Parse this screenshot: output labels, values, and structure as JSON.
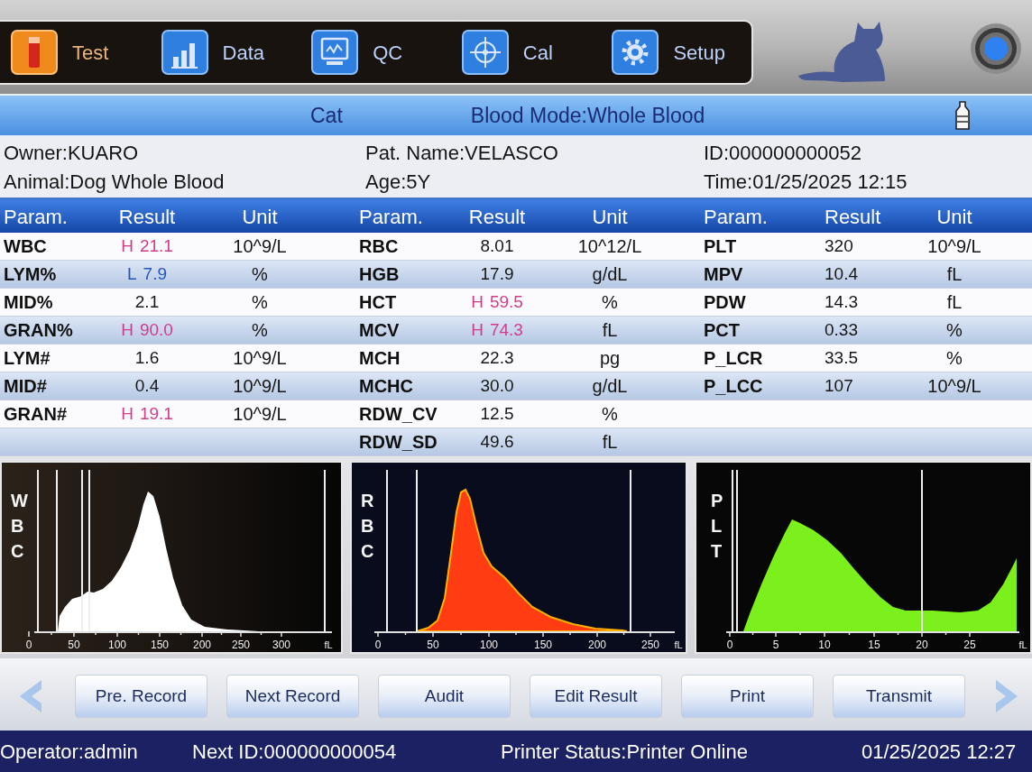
{
  "toolbar": {
    "tabs": [
      {
        "label": "Test",
        "selected": true
      },
      {
        "label": "Data",
        "selected": false
      },
      {
        "label": "QC",
        "selected": false
      },
      {
        "label": "Cal",
        "selected": false
      },
      {
        "label": "Setup",
        "selected": false
      }
    ]
  },
  "mode_bar": {
    "species": "Cat",
    "blood_mode": "Blood Mode:Whole Blood"
  },
  "patient_info": {
    "owner": "Owner:KUARO",
    "patient_name": "Pat. Name:VELASCO",
    "id": "ID:000000000052",
    "animal": "Animal:Dog Whole Blood",
    "age": "Age:5Y",
    "time": "Time:01/25/2025 12:15"
  },
  "results_table": {
    "columns": [
      "Param.",
      "Result",
      "Unit",
      "Param.",
      "Result",
      "Unit",
      "Param.",
      "Result",
      "Unit"
    ],
    "groups": [
      {
        "rows": [
          {
            "param": "WBC",
            "flag": "H",
            "result": "21.1",
            "unit": "10^9/L",
            "kind": "high"
          },
          {
            "param": "LYM%",
            "flag": "L",
            "result": "7.9",
            "unit": "%",
            "kind": "low"
          },
          {
            "param": "MID%",
            "result": "2.1",
            "unit": "%",
            "kind": "normal"
          },
          {
            "param": "GRAN%",
            "flag": "H",
            "result": "90.0",
            "unit": "%",
            "kind": "high"
          },
          {
            "param": "LYM#",
            "result": "1.6",
            "unit": "10^9/L",
            "kind": "normal"
          },
          {
            "param": "MID#",
            "result": "0.4",
            "unit": "10^9/L",
            "kind": "normal"
          },
          {
            "param": "GRAN#",
            "flag": "H",
            "result": "19.1",
            "unit": "10^9/L",
            "kind": "high"
          }
        ]
      },
      {
        "rows": [
          {
            "param": "RBC",
            "result": "8.01",
            "unit": "10^12/L",
            "kind": "normal"
          },
          {
            "param": "HGB",
            "result": "17.9",
            "unit": "g/dL",
            "kind": "normal"
          },
          {
            "param": "HCT",
            "flag": "H",
            "result": "59.5",
            "unit": "%",
            "kind": "high"
          },
          {
            "param": "MCV",
            "flag": "H",
            "result": "74.3",
            "unit": "fL",
            "kind": "high"
          },
          {
            "param": "MCH",
            "result": "22.3",
            "unit": "pg",
            "kind": "normal"
          },
          {
            "param": "MCHC",
            "result": "30.0",
            "unit": "g/dL",
            "kind": "normal"
          },
          {
            "param": "RDW_CV",
            "result": "12.5",
            "unit": "%",
            "kind": "normal"
          },
          {
            "param": "RDW_SD",
            "result": "49.6",
            "unit": "fL",
            "kind": "normal"
          }
        ]
      },
      {
        "rows": [
          {
            "param": "PLT",
            "result": "320",
            "unit": "10^9/L",
            "kind": "normal"
          },
          {
            "param": "MPV",
            "result": "10.4",
            "unit": "fL",
            "kind": "normal"
          },
          {
            "param": "PDW",
            "result": "14.3",
            "unit": "fL",
            "kind": "normal"
          },
          {
            "param": "PCT",
            "result": "0.33",
            "unit": "%",
            "kind": "normal"
          },
          {
            "param": "P_LCR",
            "result": "33.5",
            "unit": "%",
            "kind": "normal"
          },
          {
            "param": "P_LCC",
            "result": "107",
            "unit": "10^9/L",
            "kind": "normal"
          }
        ]
      }
    ]
  },
  "histograms": [
    {
      "kind": "wbc",
      "label": "WBC",
      "unit": "fL",
      "color": "#ffffff",
      "tick_labels": [
        "0",
        "50",
        "100",
        "150",
        "200",
        "250",
        "300"
      ]
    },
    {
      "kind": "rbc",
      "label": "RBC",
      "unit": "fL",
      "color": "#ff3c12",
      "tick_labels": [
        "0",
        "50",
        "100",
        "150",
        "200",
        "250"
      ]
    },
    {
      "kind": "plt",
      "label": "PLT",
      "unit": "fL",
      "color": "#7cf01c",
      "tick_labels": [
        "0",
        "5",
        "10",
        "15",
        "20",
        "25"
      ]
    }
  ],
  "actions": {
    "buttons": [
      "Pre. Record",
      "Next Record",
      "Audit",
      "Edit Result",
      "Print",
      "Transmit"
    ]
  },
  "status_bar": {
    "operator": "Operator:admin",
    "next_id": "Next ID:000000000054",
    "printer_status": "Printer Status:Printer Online",
    "datetime": "01/25/2025 12:27"
  }
}
